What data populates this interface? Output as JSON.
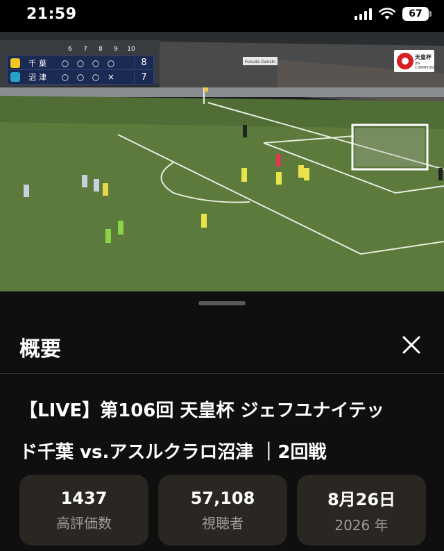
{
  "status_bar": {
    "time": "21:59",
    "battery": "67"
  },
  "video": {
    "scoreboard": {
      "innings": [
        "6",
        "7",
        "8",
        "9",
        "10"
      ],
      "teams": [
        {
          "name": "千葉",
          "marks": [
            "○",
            "○",
            "○",
            "○",
            ""
          ],
          "total": "8",
          "badge_color": "#f3c623"
        },
        {
          "name": "沼津",
          "marks": [
            "○",
            "○",
            "○",
            "×",
            ""
          ],
          "total": "7",
          "badge_color": "#27a3c9"
        }
      ]
    },
    "stadium_sign": "Fukuda Denshi",
    "logo": {
      "title": "天皇杯",
      "subtitle": "JFA",
      "caption": "CHAMPIONSHIP"
    }
  },
  "sheet": {
    "title": "概要",
    "video_title_line1": "【LIVE】第106回 天皇杯 ジェフユナイテッ",
    "video_title_line2": "ド千葉 vs.アスルクラロ沼津 ｜2回戦",
    "stats": [
      {
        "value": "1437",
        "label": "高評価数"
      },
      {
        "value": "57,108",
        "label": "視聴者"
      },
      {
        "value": "8月26日",
        "label": "2026 年"
      }
    ]
  },
  "colors": {
    "pitch": "#5b7a3c",
    "sheet_bg": "#0f0f0f",
    "card_bg": "#2a2622",
    "scoreboard": "#1b2a52"
  }
}
